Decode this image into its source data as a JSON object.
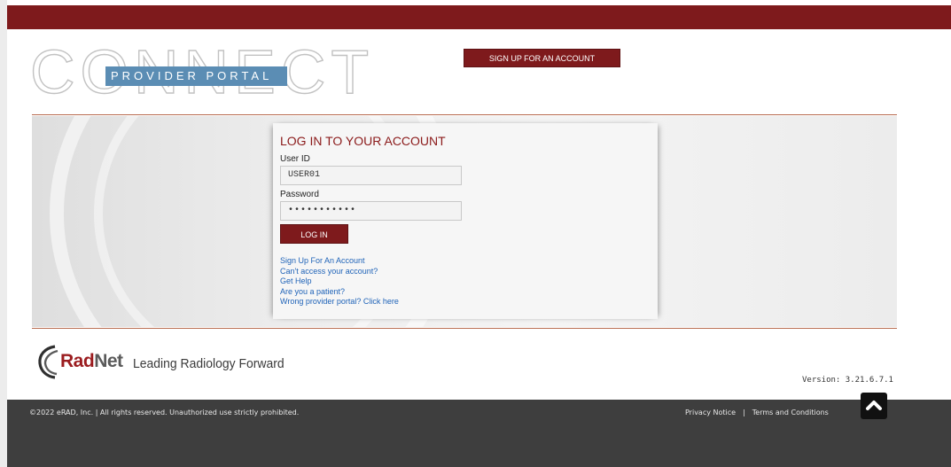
{
  "header": {
    "logo_word": "CONNECT",
    "logo_band": "PROVIDER PORTAL",
    "signup_button": "SIGN UP FOR AN ACCOUNT"
  },
  "login": {
    "title": "LOG IN TO YOUR ACCOUNT",
    "userid_label": "User ID",
    "userid_value": "USER01",
    "password_label": "Password",
    "password_value": "•••••••••••",
    "login_button": "LOG IN",
    "links": [
      "Sign Up For An Account",
      "Can't access your account?",
      "Get Help",
      "Are you a patient?",
      "Wrong provider portal? Click here"
    ]
  },
  "brand": {
    "rad": "Rad",
    "net": "Net",
    "tagline": "Leading Radiology Forward"
  },
  "version": "Version: 3.21.6.7.1",
  "footer": {
    "copyright": "©2022 eRAD, Inc.  |  All rights reserved. Unauthorized use strictly prohibited.",
    "privacy": "Privacy Notice",
    "separator": "|",
    "terms": "Terms and Conditions",
    "scroll_top_icon": "chevron-up-icon"
  },
  "colors": {
    "accent": "#7e1a1c",
    "link": "#1f63b8",
    "logo_band": "#5b8db4",
    "footer_bg": "#3e3e3e"
  }
}
